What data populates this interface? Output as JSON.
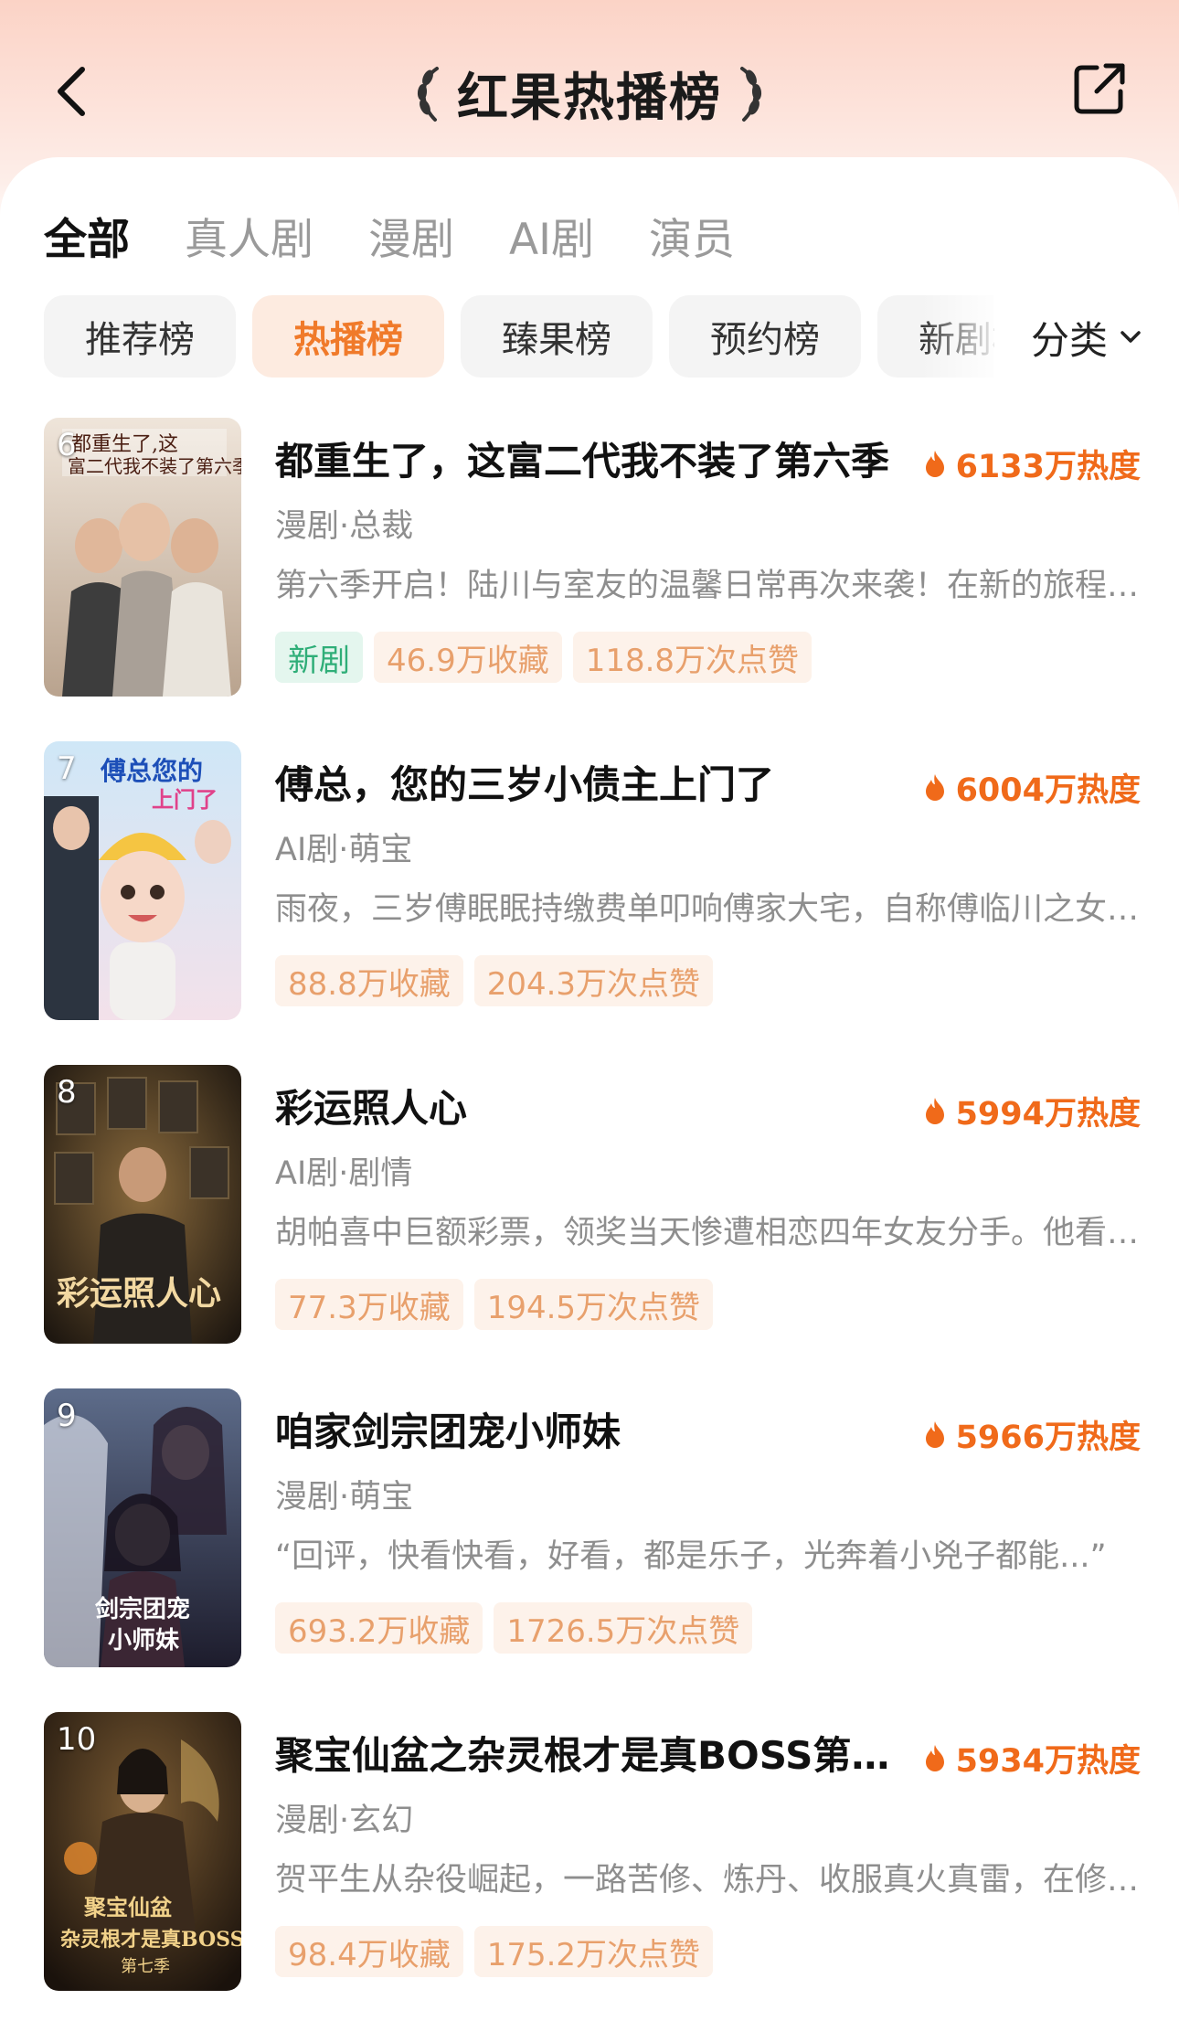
{
  "header": {
    "title": "红果热播榜",
    "back_icon": "chevron-left-icon",
    "share_icon": "share-icon"
  },
  "tabs": [
    {
      "label": "全部",
      "active": true
    },
    {
      "label": "真人剧",
      "active": false
    },
    {
      "label": "漫剧",
      "active": false
    },
    {
      "label": "AI剧",
      "active": false
    },
    {
      "label": "演员",
      "active": false
    }
  ],
  "chips": [
    {
      "label": "推荐榜",
      "active": false
    },
    {
      "label": "热播榜",
      "active": true
    },
    {
      "label": "臻果榜",
      "active": false
    },
    {
      "label": "预约榜",
      "active": false
    },
    {
      "label": "新剧榜",
      "active": false
    }
  ],
  "category": {
    "label": "分类",
    "icon": "chevron-down-icon"
  },
  "colors": {
    "accent": "#f06a1a",
    "badge_text": "#e8a06c",
    "badge_bg": "#fdf2ea",
    "new_badge_text": "#2fae78",
    "new_badge_bg": "#e4f6ee"
  },
  "items": [
    {
      "rank": "6",
      "title": "都重生了，这富二代我不装了第六季",
      "heat": "6133万热度",
      "tags": "漫剧·总裁",
      "desc": "第六季开启！陆川与室友的温馨日常再次来袭！在新的旅程中，他们又将迎来怎样的挑战与成长",
      "badges": [
        {
          "text": "新剧",
          "type": "new"
        },
        {
          "text": "46.9万收藏"
        },
        {
          "text": "118.8万次点赞"
        }
      ],
      "poster_text": "都重生了,这富二代我不装了第六季"
    },
    {
      "rank": "7",
      "title": "傅总，您的三岁小债主上门了",
      "heat": "6004万热度",
      "tags": "AI剧·萌宝",
      "desc": "雨夜，三岁傅眠眠持缴费单叩响傅家大宅，自称傅临川之女，前来讨债",
      "badges": [
        {
          "text": "88.8万收藏"
        },
        {
          "text": "204.3万次点赞"
        }
      ],
      "poster_text": "傅总您的上门了"
    },
    {
      "rank": "8",
      "title": "彩运照人心",
      "heat": "5994万热度",
      "tags": "AI剧·剧情",
      "desc": "胡帕喜中巨额彩票，领奖当天惨遭相恋四年女友分手。他看透人心，决定隐瞒中奖的事实",
      "badges": [
        {
          "text": "77.3万收藏"
        },
        {
          "text": "194.5万次点赞"
        }
      ],
      "poster_text": "彩运照人心"
    },
    {
      "rank": "9",
      "title": "咱家剑宗团宠小师妹",
      "heat": "5966万热度",
      "tags": "漫剧·萌宝",
      "desc": "“回评，快看快看，好看，都是乐子，光奔着小兇子都能...”",
      "badges": [
        {
          "text": "693.2万收藏"
        },
        {
          "text": "1726.5万次点赞"
        }
      ],
      "poster_text": "咱家剑宗团宠小师妹"
    },
    {
      "rank": "10",
      "title": "聚宝仙盆之杂灵根才是真BOSS第七季",
      "heat": "5934万热度",
      "tags": "漫剧·玄幻",
      "desc": "贺平生从杂役崛起，一路苦修、炼丹、收服真火真雷，在修仙界闯出一片天地",
      "badges": [
        {
          "text": "98.4万收藏"
        },
        {
          "text": "175.2万次点赞"
        }
      ],
      "poster_text": "聚宝仙盆之杂灵根才是真BOSS第七季"
    }
  ]
}
